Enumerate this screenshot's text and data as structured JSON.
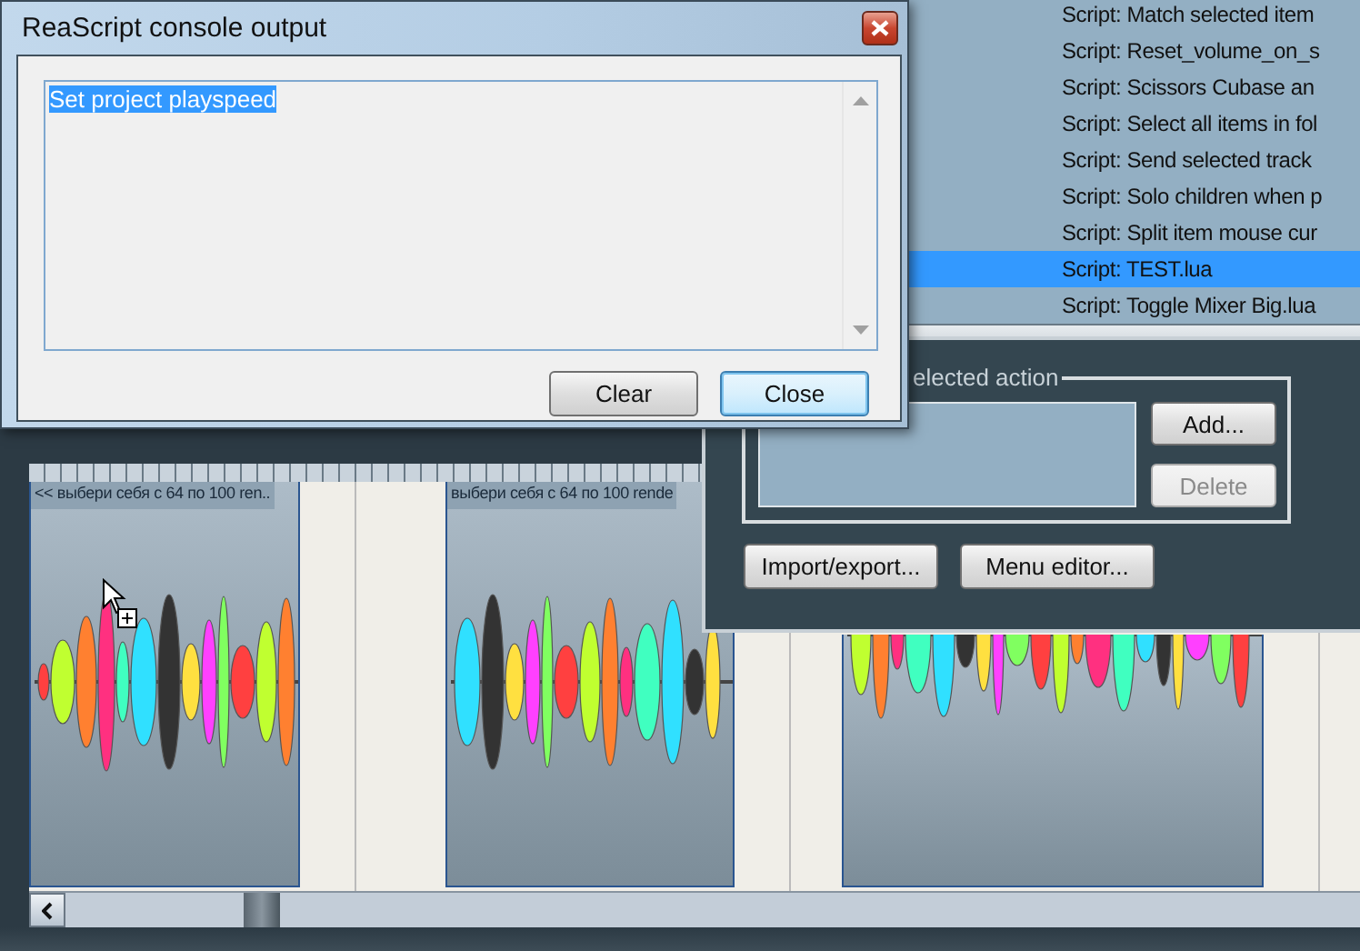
{
  "console_window": {
    "title": "ReaScript console output",
    "output": {
      "text": "Set project playspeed",
      "selected": true
    },
    "buttons": [
      {
        "label": "Clear",
        "focused": false
      },
      {
        "label": "Close",
        "focused": true
      }
    ]
  },
  "action_list": {
    "items": [
      {
        "label": "Script: Match selected item",
        "selected": false
      },
      {
        "label": "Script: Reset_volume_on_s",
        "selected": false
      },
      {
        "label": "Script: Scissors Cubase an",
        "selected": false
      },
      {
        "label": "Script: Select all items in fol",
        "selected": false
      },
      {
        "label": "Script: Send selected track",
        "selected": false
      },
      {
        "label": "Script: Solo children when p",
        "selected": false
      },
      {
        "label": "Script: Split item mouse cur",
        "selected": false
      },
      {
        "label": "Script: TEST.lua",
        "selected": true
      },
      {
        "label": "Script: Toggle Mixer Big.lua",
        "selected": false
      }
    ]
  },
  "actions_dialog": {
    "group_label": "elected action",
    "buttons": [
      {
        "label": "Add...",
        "disabled": false
      },
      {
        "label": "Delete",
        "disabled": true
      }
    ],
    "bottom_buttons": [
      {
        "label": "Import/export..."
      },
      {
        "label": "Menu editor..."
      }
    ]
  },
  "arrange": {
    "clip_labels": [
      "<< выбери себя с 64 по 100 ren..",
      "выбери себя с 64 по 100 rende"
    ]
  }
}
